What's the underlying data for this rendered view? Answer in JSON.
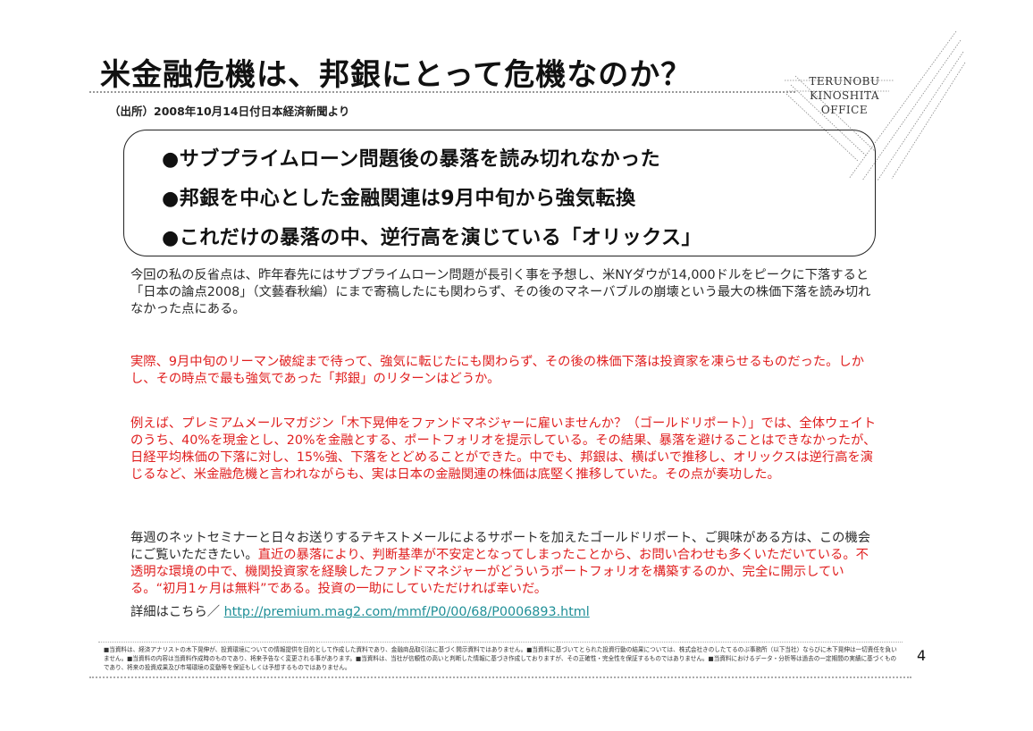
{
  "slide": {
    "title": "米金融危機は、邦銀にとって危機なのか？",
    "source": "（出所）2008年10月14日付日本経済新聞より",
    "logo": [
      "TERUNOBU",
      "KINOSHITA",
      "OFFICE"
    ],
    "key_points": [
      "●サブプライムローン問題後の暴落を読み切れなかった",
      "●邦銀を中心とした金融関連は9月中旬から強気転換",
      "●これだけの暴落の中、逆行高を演じている「オリックス」"
    ],
    "paragraphs": {
      "p1": "今回の私の反省点は、昨年春先にはサブプライムローン問題が長引く事を予想し、米NYダウが14,000ドルをピークに下落すると「日本の論点2008」（文藝春秋編）にまで寄稿したにも関わらず、その後のマネーバブルの崩壊という最大の株価下落を読み切れなかった点にある。",
      "p2": "実際、9月中旬のリーマン破綻まで待って、強気に転じたにも関わらず、その後の株価下落は投資家を凍らせるものだった。しかし、その時点で最も強気であった「邦銀」のリターンはどうか。",
      "p3": "例えば、プレミアムメールマガジン「木下晃伸をファンドマネジャーに雇いませんか？（ゴールドリポート）」では、全体ウェイトのうち、40%を現金とし、20%を金融とする、ポートフォリオを提示している。その結果、暴落を避けることはできなかったが、日経平均株価の下落に対し、15%強、下落をとどめることができた。中でも、邦銀は、横ばいで推移し、オリックスは逆行高を演じるなど、米金融危機と言われながらも、実は日本の金融関連の株価は底堅く推移していた。その点が奏功した。",
      "p4_black": "毎週のネットセミナーと日々お送りするテキストメールによるサポートを加えたゴールドリポート、ご興味がある方は、この機会にご覧いただきたい。",
      "p4_red": "直近の暴落により、判断基準が不安定となってしまったことから、お問い合わせも多くいただいている。不透明な環境の中で、機関投資家を経験したファンドマネジャーがどういうポートフォリオを構築するのか、完全に開示している。“初月1ヶ月は無料”である。投資の一助にしていただければ幸いだ。",
      "detail_label": "詳細はこちら／",
      "detail_link": "http://premium.mag2.com/mmf/P0/00/68/P0006893.html"
    },
    "disclaimer": "■当資料は、経済アナリストの木下晃伸が、投資環境についての情報提供を目的として作成した資料であり、金融商品取引法に基づく開示資料ではありません。■当資料に基づいてとられた投資行動の結果については、株式会社きのしたてるのぶ事務所（以下当社）ならびに木下晃伸は一切責任を負いません。■当資料の内容は当資料作成時のものであり、将来予告なく変更される事があります。■当資料は、当社が信頼性の高いと判断した情報に基づき作成しておりますが、その正確性・完全性を保証するものではありません。■当資料におけるデータ・分析等は過去の一定期間の実績に基づくものであり、将来の投資成果及び市場環境の変動等を保証もしくは予想するものではありません。",
    "page_number": "4",
    "colors": {
      "accent_red": "#e02020",
      "link": "#1f8f97",
      "text": "#2a2a2a"
    }
  }
}
